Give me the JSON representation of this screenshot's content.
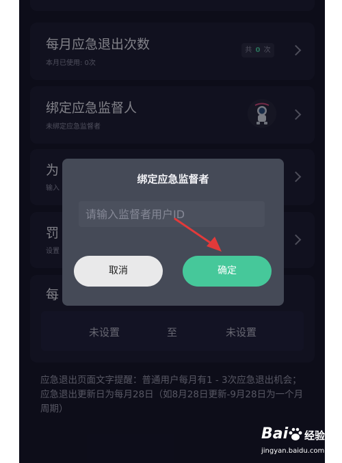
{
  "settings": {
    "monthly_exit": {
      "title": "每月应急退出次数",
      "used_label": "本月已使用: 0次",
      "count_prefix": "共",
      "count_value": "0",
      "count_suffix": "次"
    },
    "supervisor": {
      "title": "绑定应急监督人",
      "subtitle": "未绑定应急监督者"
    },
    "row3": {
      "title_fragment": "为",
      "subtitle_fragment": "输入"
    },
    "row4": {
      "title_fragment": "罚",
      "subtitle_fragment": "设置"
    },
    "row5": {
      "title_fragment": "每"
    },
    "range": {
      "start": "未设置",
      "separator": "至",
      "end": "未设置"
    }
  },
  "tip": "应急退出页面文字提醒：普通用户每月有1 - 3次应急退出机会；应急退出更新日为每月28日（如8月28日更新-9月28日为一个月周期）",
  "dialog": {
    "title": "绑定应急监督者",
    "input_placeholder": "请输入监督者用户ID",
    "cancel_label": "取消",
    "confirm_label": "确定"
  },
  "watermark": {
    "brand": "Bai",
    "brand_suffix": "经验",
    "url": "jingyan.baidu.com"
  },
  "colors": {
    "background": "#141425",
    "card": "#1d1d31",
    "dialog": "#454a57",
    "confirm": "#46c89a",
    "arrow": "#e23a3a"
  }
}
